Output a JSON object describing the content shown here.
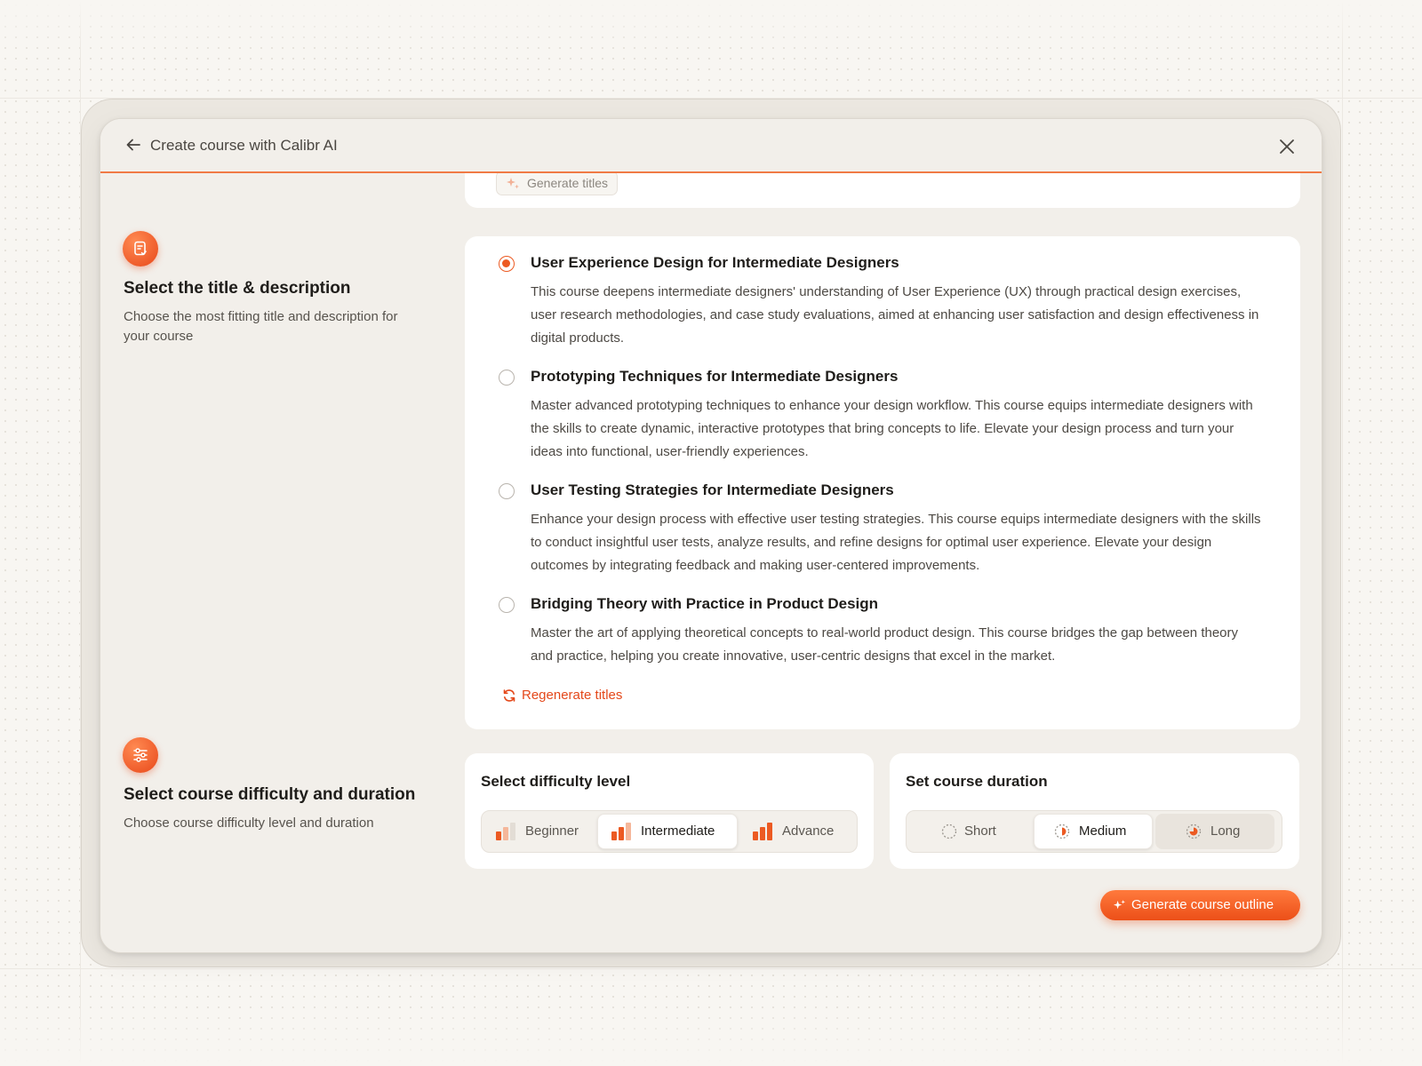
{
  "header": {
    "title": "Create course with Calibr AI"
  },
  "top": {
    "generate_titles_label": "Generate titles"
  },
  "section_title": {
    "heading": "Select the title & description",
    "description": "Choose the most fitting title and description for your course"
  },
  "options": [
    {
      "title": "User Experience Design for Intermediate Designers",
      "description": "This course deepens intermediate designers' understanding of User Experience (UX) through practical design exercises, user research methodologies, and case study evaluations, aimed at enhancing user satisfaction and design effectiveness in digital products.",
      "selected": true
    },
    {
      "title": "Prototyping Techniques for Intermediate Designers",
      "description": "Master advanced prototyping techniques to enhance your design workflow. This course equips intermediate designers with the skills to create dynamic, interactive prototypes that bring concepts to life. Elevate your design process and turn your ideas into functional, user-friendly experiences.",
      "selected": false
    },
    {
      "title": "User Testing Strategies for Intermediate Designers",
      "description": "Enhance your design process with effective user testing strategies. This course equips intermediate designers with the skills to conduct insightful user tests, analyze results, and refine designs for optimal user experience. Elevate your design outcomes by integrating feedback and making user-centered improvements.",
      "selected": false
    },
    {
      "title": "Bridging Theory with Practice in Product Design",
      "description": "Master the art of applying theoretical concepts to real-world product design. This course bridges the gap between theory and practice, helping you create innovative, user-centric designs that excel in the market.",
      "selected": false
    }
  ],
  "regenerate_label": "Regenerate titles",
  "section_difficulty": {
    "heading": "Select course difficulty and duration",
    "description": "Choose course difficulty level and duration"
  },
  "difficulty": {
    "heading": "Select difficulty level",
    "options": [
      "Beginner",
      "Intermediate",
      "Advance"
    ],
    "selected": "Intermediate"
  },
  "duration": {
    "heading": "Set course duration",
    "options": [
      "Short",
      "Medium",
      "Long"
    ],
    "selected": "Medium"
  },
  "cta_label": "Generate course outline",
  "colors": {
    "accent": "#ec5a22",
    "accent_light": "#f5b79a",
    "background": "#f2efea"
  }
}
